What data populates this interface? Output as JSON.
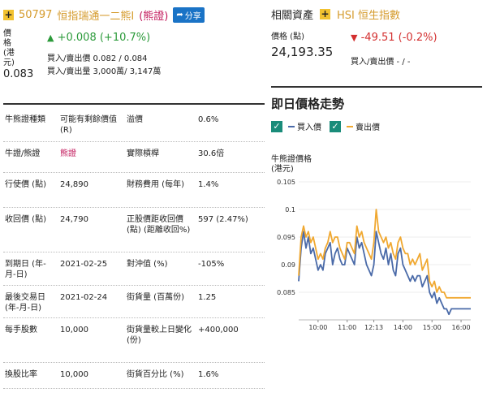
{
  "header": {
    "code": "50797",
    "name": "恒指瑞通一二熊I",
    "tag": "(熊證)",
    "share_label": "分享"
  },
  "price_block": {
    "label": "價格(港元)",
    "value": "0.083",
    "change": "+0.008 (+10.7%)",
    "bid_ask_price": "買入/賣出價 0.082 / 0.084",
    "bid_ask_volume": "買入/賣出量 3,000萬/ 3,147萬"
  },
  "related": {
    "title": "相關資產",
    "asset": "HSI 恒生指數",
    "price_label": "價格 (點)",
    "price_value": "24,193.35",
    "change": "-49.51 (-0.2%)",
    "bid_ask": "買入/賣出價 - / -"
  },
  "table": {
    "rows": [
      {
        "k1": "牛熊證種類",
        "v1": "可能有剩餘價值 (R)",
        "k2": "溢價",
        "v2": "0.6%"
      },
      {
        "k1": "牛證/熊證",
        "v1": "熊證",
        "k2": "實際槓桿",
        "v2": "30.6倍"
      },
      {
        "k1": "行使價 (點)",
        "v1": "24,890",
        "k2": "財務費用 (每年)",
        "v2": "1.4%"
      },
      {
        "k1": "收回價 (點)",
        "v1": "24,790",
        "k2": "正股價距收回價 (點) (距離收回%)",
        "v2": "597 (2.47%)"
      },
      {
        "k1": "到期日 (年-月-日)",
        "v1": "2021-02-25",
        "k2": "對沖值 (%)",
        "v2": "-105%"
      },
      {
        "k1": "最後交易日 (年-月-日)",
        "v1": "2021-02-24",
        "k2": "街貨量 (百萬份)",
        "v2": "1.25"
      },
      {
        "k1": "每手股數",
        "v1": "10,000",
        "k2": "街貨量較上日變化 (份)",
        "v2": "+400,000"
      },
      {
        "k1": "換股比率",
        "v1": "10,000",
        "k2": "街貨百分比 (%)",
        "v2": "1.6%"
      }
    ]
  },
  "chart_section": {
    "title": "即日價格走勢",
    "legend_bid": "買入價",
    "legend_ask": "賣出價",
    "bid_color": "#4a6aa8",
    "ask_color": "#f0a830"
  },
  "chart_data": {
    "type": "line",
    "ylabel": "牛熊證價格 (港元)",
    "ylim": [
      0.08,
      0.105
    ],
    "yticks": [
      "0.105",
      "0.1",
      "0.095",
      "0.09",
      "0.085"
    ],
    "xticks": [
      "10:00",
      "11:00",
      "12:13",
      "14:00",
      "15:00",
      "16:00"
    ],
    "x": [
      0,
      1,
      2,
      3,
      4,
      5,
      6,
      7,
      8,
      9,
      10,
      11,
      12,
      13,
      14,
      15,
      16,
      17,
      18,
      19,
      20,
      21,
      22,
      23,
      24,
      25,
      26,
      27,
      28,
      29,
      30,
      31,
      32,
      33,
      34,
      35,
      36,
      37,
      38,
      39,
      40,
      41,
      42,
      43,
      44,
      45,
      46,
      47,
      48,
      49,
      50,
      51,
      52,
      53,
      54,
      55,
      56,
      57,
      58,
      59,
      60,
      61,
      62,
      63,
      64,
      65,
      66,
      67,
      68,
      69,
      70,
      71
    ],
    "series": [
      {
        "name": "買入價",
        "values": [
          0.087,
          0.093,
          0.096,
          0.093,
          0.095,
          0.092,
          0.093,
          0.091,
          0.089,
          0.09,
          0.089,
          0.092,
          0.093,
          0.094,
          0.09,
          0.092,
          0.093,
          0.091,
          0.09,
          0.09,
          0.093,
          0.092,
          0.091,
          0.09,
          0.095,
          0.093,
          0.094,
          0.092,
          0.09,
          0.089,
          0.088,
          0.09,
          0.096,
          0.094,
          0.092,
          0.091,
          0.093,
          0.09,
          0.092,
          0.089,
          0.088,
          0.092,
          0.093,
          0.09,
          0.089,
          0.088,
          0.087,
          0.088,
          0.087,
          0.088,
          0.088,
          0.086,
          0.087,
          0.088,
          0.085,
          0.084,
          0.085,
          0.083,
          0.084,
          0.083,
          0.082,
          0.082,
          0.081,
          0.082,
          0.082,
          0.082,
          0.082,
          0.082,
          0.082,
          0.082,
          0.082,
          0.082
        ]
      },
      {
        "name": "賣出價",
        "values": [
          0.088,
          0.095,
          0.097,
          0.095,
          0.096,
          0.094,
          0.095,
          0.093,
          0.091,
          0.092,
          0.091,
          0.093,
          0.094,
          0.096,
          0.094,
          0.095,
          0.095,
          0.093,
          0.092,
          0.091,
          0.094,
          0.094,
          0.093,
          0.092,
          0.097,
          0.095,
          0.096,
          0.094,
          0.093,
          0.092,
          0.091,
          0.094,
          0.1,
          0.096,
          0.095,
          0.094,
          0.095,
          0.093,
          0.094,
          0.092,
          0.091,
          0.094,
          0.095,
          0.093,
          0.092,
          0.092,
          0.09,
          0.091,
          0.09,
          0.091,
          0.092,
          0.089,
          0.09,
          0.091,
          0.087,
          0.086,
          0.087,
          0.085,
          0.086,
          0.085,
          0.085,
          0.084,
          0.084,
          0.084,
          0.084,
          0.084,
          0.084,
          0.084,
          0.084,
          0.084,
          0.084,
          0.084
        ]
      }
    ],
    "legend": "top-left",
    "grid": true
  }
}
